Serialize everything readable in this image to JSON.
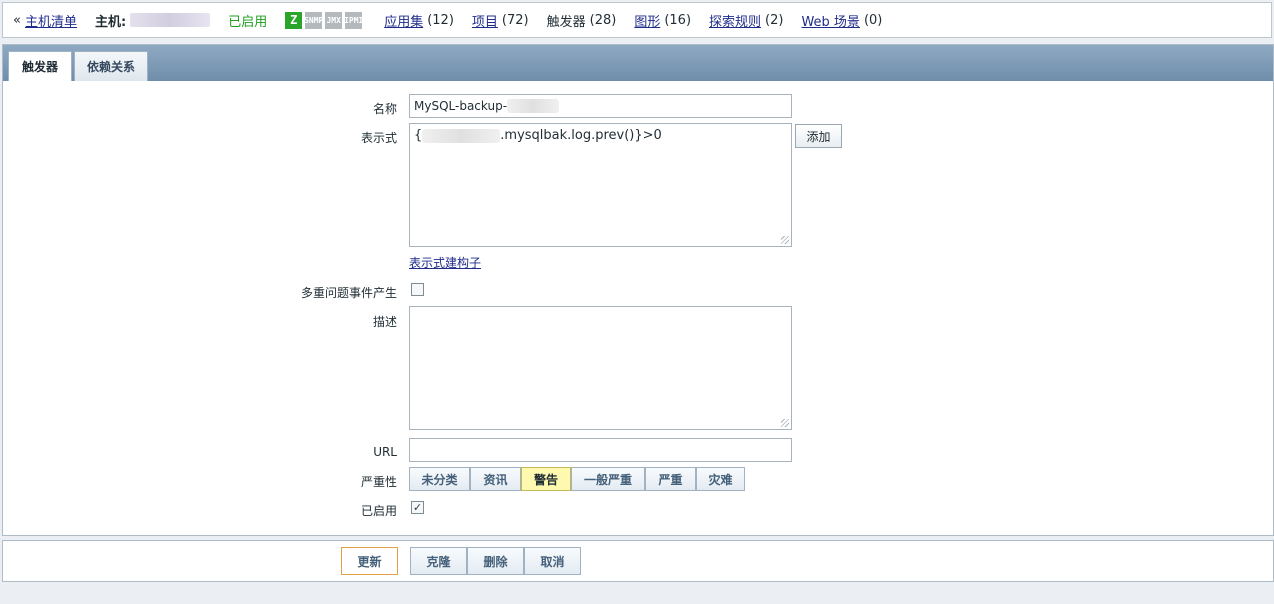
{
  "topbar": {
    "back_prefix": "«",
    "host_list": "主机清单",
    "host_label": "主机:",
    "status": "已启用",
    "availability_icons": [
      {
        "name": "zabbix-agent-icon",
        "glyph": "Z"
      },
      {
        "name": "snmp-icon",
        "glyph": "SNMP"
      },
      {
        "name": "jmx-icon",
        "glyph": "JMX"
      },
      {
        "name": "ipmi-icon",
        "glyph": "IPMI"
      }
    ],
    "links": [
      {
        "label": "应用集",
        "count": "(12)",
        "is_link": true
      },
      {
        "label": "项目",
        "count": "(72)",
        "is_link": true
      },
      {
        "label": "触发器",
        "count": "(28)",
        "is_link": false
      },
      {
        "label": "图形",
        "count": "(16)",
        "is_link": true
      },
      {
        "label": "探索规则",
        "count": "(2)",
        "is_link": true
      },
      {
        "label": "Web 场景",
        "count": "(0)",
        "is_link": true
      }
    ]
  },
  "tabs": [
    {
      "label": "触发器",
      "active": true
    },
    {
      "label": "依赖关系",
      "active": false
    }
  ],
  "form": {
    "name_label": "名称",
    "name_value": "MySQL-backup-",
    "expression_label": "表示式",
    "expression_prefix": "{",
    "expression_suffix": ".mysqlbak.log.prev()}>0",
    "add_button": "添加",
    "expression_builder": "表示式建构子",
    "multiple_events_label": "多重问题事件产生",
    "multiple_events_checked": false,
    "description_label": "描述",
    "description_value": "",
    "url_label": "URL",
    "url_value": "",
    "severity_label": "严重性",
    "severities": [
      "未分类",
      "资讯",
      "警告",
      "一般严重",
      "严重",
      "灾难"
    ],
    "severity_selected": "警告",
    "enabled_label": "已启用",
    "enabled_checked": true,
    "check_mark": "✓"
  },
  "footer": {
    "update": "更新",
    "clone": "克隆",
    "delete": "删除",
    "cancel": "取消"
  }
}
